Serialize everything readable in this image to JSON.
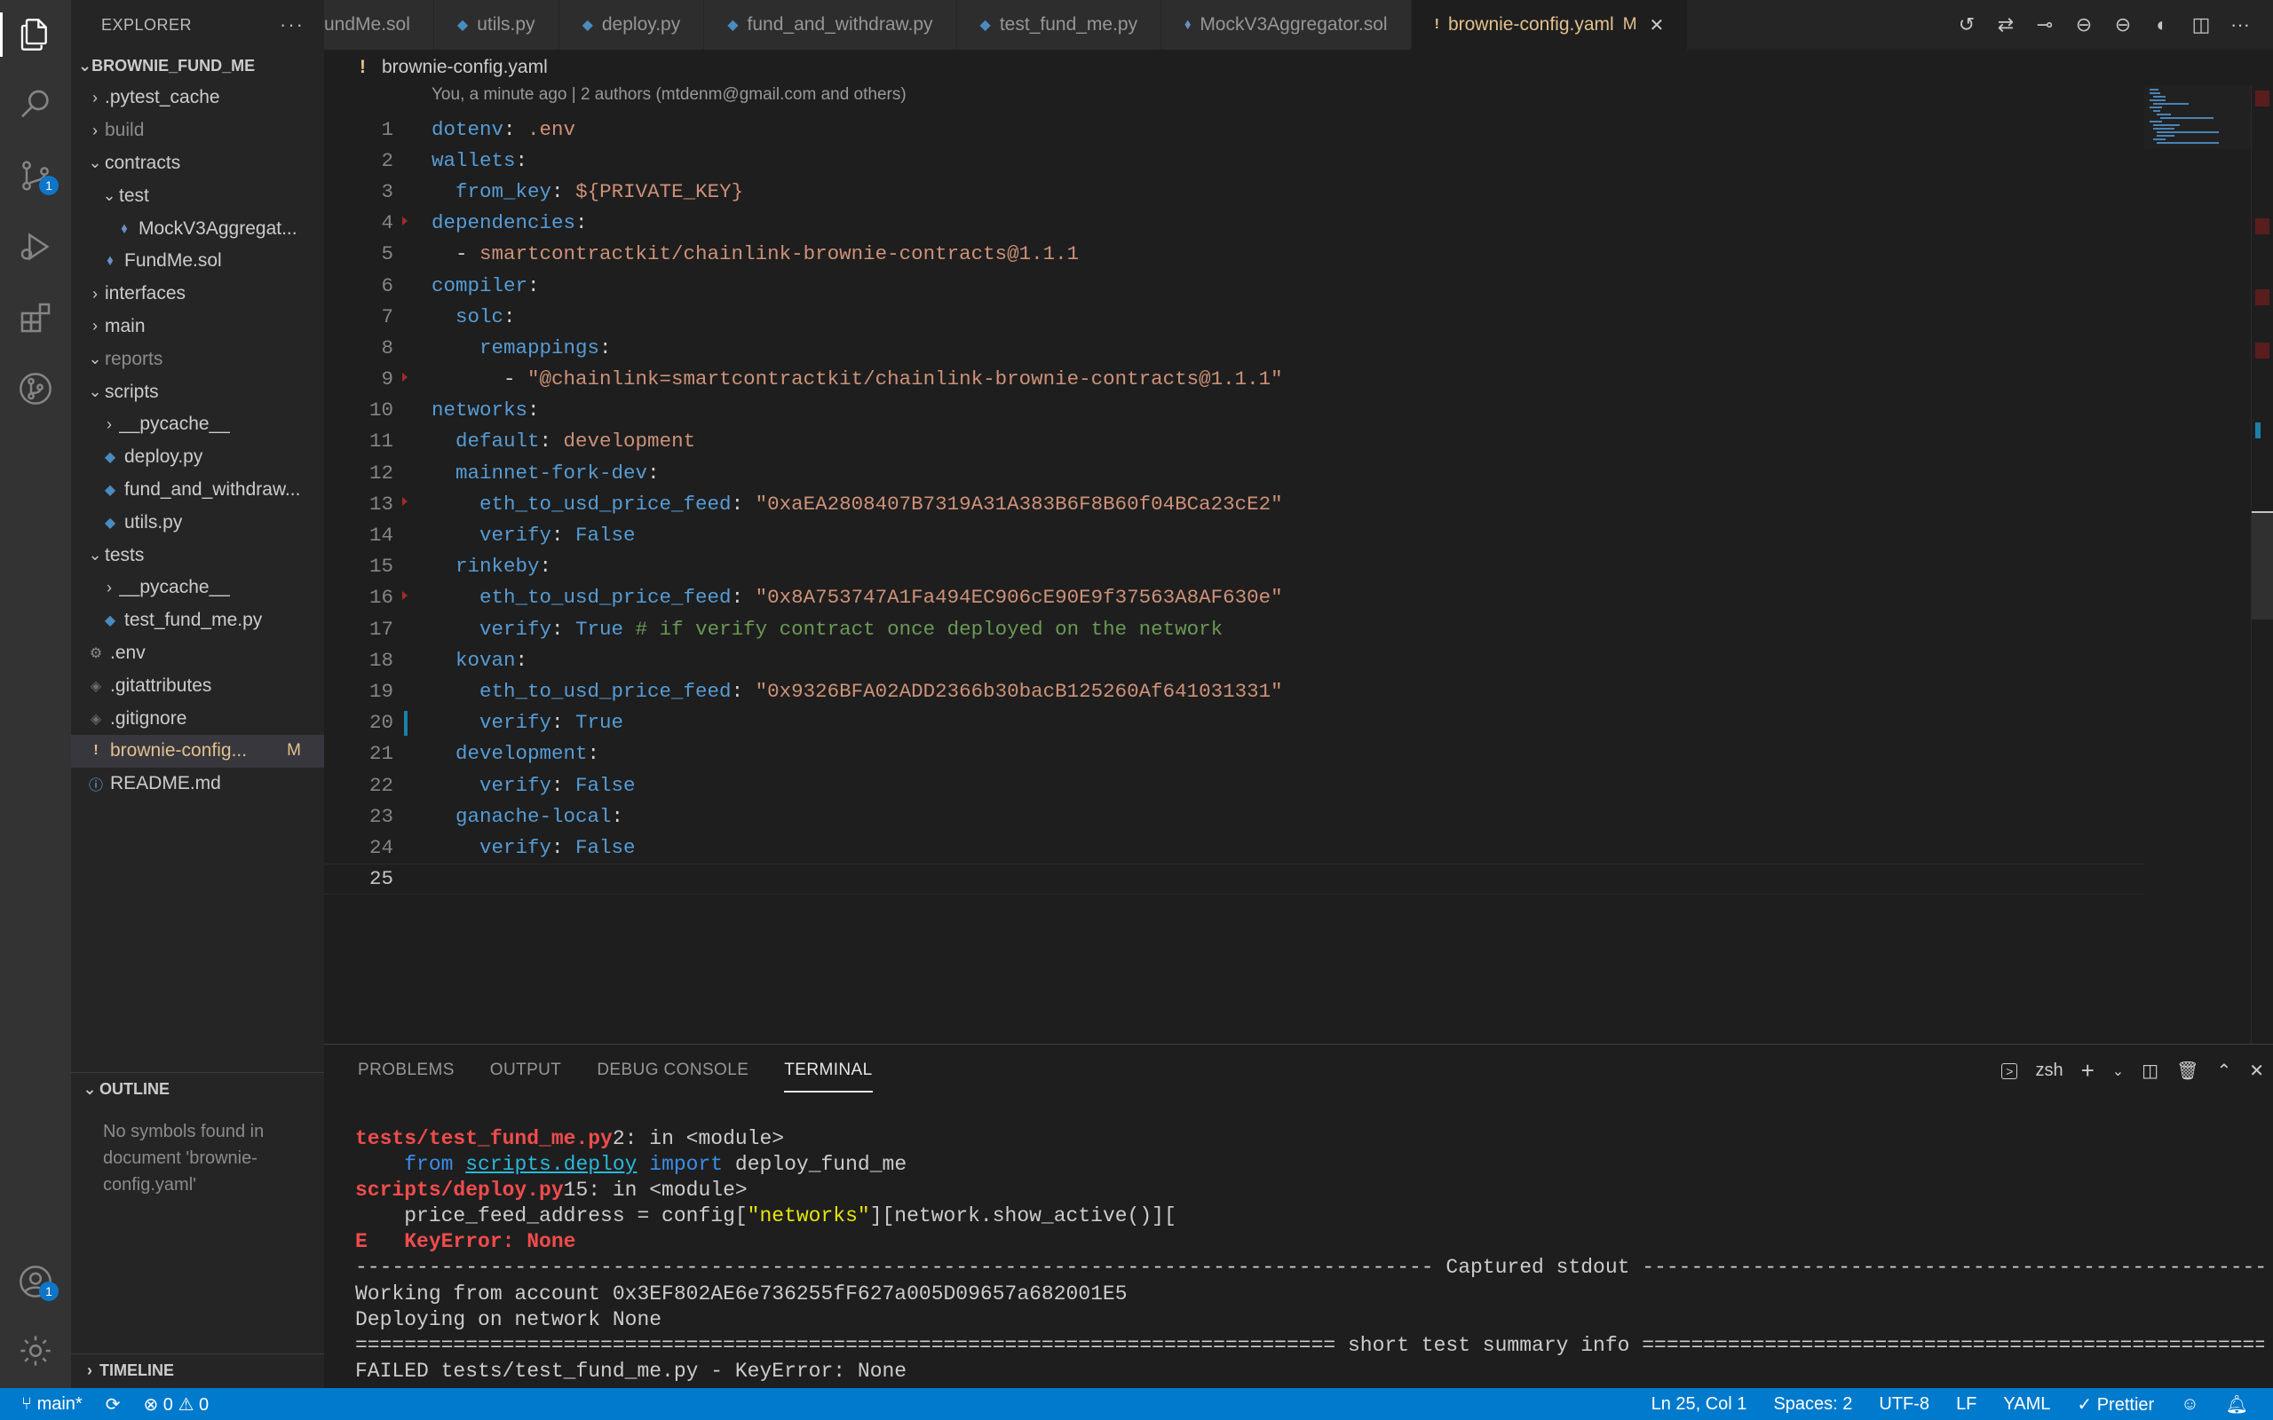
{
  "explorer": {
    "title": "EXPLORER",
    "project": "BROWNIE_FUND_ME",
    "items": [
      {
        "label": ".pytest_cache",
        "kind": "folder",
        "state": "collapsed",
        "depth": 0
      },
      {
        "label": "build",
        "kind": "folder",
        "state": "collapsed",
        "depth": 0,
        "muted": true
      },
      {
        "label": "contracts",
        "kind": "folder",
        "state": "expanded",
        "depth": 0
      },
      {
        "label": "test",
        "kind": "folder",
        "state": "expanded",
        "depth": 1
      },
      {
        "label": "MockV3Aggregat...",
        "kind": "sol",
        "depth": 2
      },
      {
        "label": "FundMe.sol",
        "kind": "sol",
        "depth": 1
      },
      {
        "label": "interfaces",
        "kind": "folder",
        "state": "collapsed",
        "depth": 0
      },
      {
        "label": "main",
        "kind": "folder",
        "state": "collapsed",
        "depth": 0
      },
      {
        "label": "reports",
        "kind": "folder",
        "state": "expanded",
        "depth": 0,
        "muted": true
      },
      {
        "label": "scripts",
        "kind": "folder",
        "state": "expanded",
        "depth": 0
      },
      {
        "label": "__pycache__",
        "kind": "folder",
        "state": "collapsed",
        "depth": 1
      },
      {
        "label": "deploy.py",
        "kind": "py",
        "depth": 1
      },
      {
        "label": "fund_and_withdraw...",
        "kind": "py",
        "depth": 1
      },
      {
        "label": "utils.py",
        "kind": "py",
        "depth": 1
      },
      {
        "label": "tests",
        "kind": "folder",
        "state": "expanded",
        "depth": 0
      },
      {
        "label": "__pycache__",
        "kind": "folder",
        "state": "collapsed",
        "depth": 1
      },
      {
        "label": "test_fund_me.py",
        "kind": "py",
        "depth": 1
      },
      {
        "label": ".env",
        "kind": "env",
        "depth": 0
      },
      {
        "label": ".gitattributes",
        "kind": "git",
        "depth": 0
      },
      {
        "label": ".gitignore",
        "kind": "git",
        "depth": 0
      },
      {
        "label": "brownie-config...",
        "kind": "yaml",
        "depth": 0,
        "selected": true,
        "modified": "M"
      },
      {
        "label": "README.md",
        "kind": "info",
        "depth": 0
      }
    ],
    "outline_title": "OUTLINE",
    "outline_message": "No symbols found in document 'brownie-config.yaml'",
    "timeline_title": "TIMELINE"
  },
  "activity": {
    "scm_badge": "1",
    "accounts_badge": "1"
  },
  "tabs": [
    {
      "label": "undMe.sol",
      "kind": "sol"
    },
    {
      "label": "utils.py",
      "kind": "py"
    },
    {
      "label": "deploy.py",
      "kind": "py"
    },
    {
      "label": "fund_and_withdraw.py",
      "kind": "py"
    },
    {
      "label": "test_fund_me.py",
      "kind": "py"
    },
    {
      "label": "MockV3Aggregator.sol",
      "kind": "sol"
    },
    {
      "label": "brownie-config.yaml",
      "kind": "yaml",
      "active": true,
      "modified": "M"
    }
  ],
  "editor": {
    "breadcrumb": "brownie-config.yaml",
    "blame": "You, a minute ago | 2 authors (mtdenm@gmail.com and others)",
    "current_line": 25,
    "lines": [
      [
        [
          "k",
          "dotenv"
        ],
        [
          "p",
          ": "
        ],
        [
          "s",
          ".env"
        ]
      ],
      [
        [
          "k",
          "wallets"
        ],
        [
          "p",
          ":"
        ]
      ],
      [
        [
          "p",
          "  "
        ],
        [
          "k",
          "from_key"
        ],
        [
          "p",
          ": "
        ],
        [
          "s",
          "${PRIVATE_KEY}"
        ]
      ],
      [
        [
          "k",
          "dependencies"
        ],
        [
          "p",
          ":"
        ]
      ],
      [
        [
          "p",
          "  - "
        ],
        [
          "s",
          "smartcontractkit/chainlink-brownie-contracts@1.1.1"
        ]
      ],
      [
        [
          "k",
          "compiler"
        ],
        [
          "p",
          ":"
        ]
      ],
      [
        [
          "p",
          "  "
        ],
        [
          "k",
          "solc"
        ],
        [
          "p",
          ":"
        ]
      ],
      [
        [
          "p",
          "    "
        ],
        [
          "k",
          "remappings"
        ],
        [
          "p",
          ":"
        ]
      ],
      [
        [
          "p",
          "      - "
        ],
        [
          "s",
          "\"@chainlink=smartcontractkit/chainlink-brownie-contracts@1.1.1\""
        ]
      ],
      [
        [
          "k",
          "networks"
        ],
        [
          "p",
          ":"
        ]
      ],
      [
        [
          "p",
          "  "
        ],
        [
          "k",
          "default"
        ],
        [
          "p",
          ": "
        ],
        [
          "s",
          "development"
        ]
      ],
      [
        [
          "p",
          "  "
        ],
        [
          "k",
          "mainnet-fork-dev"
        ],
        [
          "p",
          ":"
        ]
      ],
      [
        [
          "p",
          "    "
        ],
        [
          "k",
          "eth_to_usd_price_feed"
        ],
        [
          "p",
          ": "
        ],
        [
          "s",
          "\"0xaEA2808407B7319A31A383B6F8B60f04BCa23cE2\""
        ]
      ],
      [
        [
          "p",
          "    "
        ],
        [
          "k",
          "verify"
        ],
        [
          "p",
          ": "
        ],
        [
          "b",
          "False"
        ]
      ],
      [
        [
          "p",
          "  "
        ],
        [
          "k",
          "rinkeby"
        ],
        [
          "p",
          ":"
        ]
      ],
      [
        [
          "p",
          "    "
        ],
        [
          "k",
          "eth_to_usd_price_feed"
        ],
        [
          "p",
          ": "
        ],
        [
          "s",
          "\"0x8A753747A1Fa494EC906cE90E9f37563A8AF630e\""
        ]
      ],
      [
        [
          "p",
          "    "
        ],
        [
          "k",
          "verify"
        ],
        [
          "p",
          ": "
        ],
        [
          "b",
          "True"
        ],
        [
          "c",
          " # if verify contract once deployed on the network"
        ]
      ],
      [
        [
          "p",
          "  "
        ],
        [
          "k",
          "kovan"
        ],
        [
          "p",
          ":"
        ]
      ],
      [
        [
          "p",
          "    "
        ],
        [
          "k",
          "eth_to_usd_price_feed"
        ],
        [
          "p",
          ": "
        ],
        [
          "s",
          "\"0x9326BFA02ADD2366b30bacB125260Af641031331\""
        ]
      ],
      [
        [
          "p",
          "    "
        ],
        [
          "k",
          "verify"
        ],
        [
          "p",
          ": "
        ],
        [
          "b",
          "True"
        ]
      ],
      [
        [
          "p",
          "  "
        ],
        [
          "k",
          "development"
        ],
        [
          "p",
          ":"
        ]
      ],
      [
        [
          "p",
          "    "
        ],
        [
          "k",
          "verify"
        ],
        [
          "p",
          ": "
        ],
        [
          "b",
          "False"
        ]
      ],
      [
        [
          "p",
          "  "
        ],
        [
          "k",
          "ganache-local"
        ],
        [
          "p",
          ":"
        ]
      ],
      [
        [
          "p",
          "    "
        ],
        [
          "k",
          "verify"
        ],
        [
          "p",
          ": "
        ],
        [
          "b",
          "False"
        ]
      ],
      []
    ]
  },
  "panel": {
    "tabs": [
      "PROBLEMS",
      "OUTPUT",
      "DEBUG CONSOLE",
      "TERMINAL"
    ],
    "active_tab": "TERMINAL",
    "shell": "zsh",
    "terminal": [
      [
        [
          "t-red",
          "tests/test_fund_me.py"
        ],
        [
          "",
          "2: in <module>"
        ]
      ],
      [
        [
          "",
          "    "
        ],
        [
          "t-blue",
          "from "
        ],
        [
          "t-cyan",
          "scripts.deploy"
        ],
        [
          "t-blue",
          " import "
        ],
        [
          "",
          "deploy_fund_me"
        ]
      ],
      [
        [
          "t-red",
          "scripts/deploy.py"
        ],
        [
          "",
          "15: in <module>"
        ]
      ],
      [
        [
          "",
          "    price_feed_address = config["
        ],
        [
          "t-yellow",
          "\"networks\""
        ],
        [
          "",
          "][network.show_active()]["
        ]
      ],
      [
        [
          "t-red",
          "E   KeyError: None"
        ]
      ],
      [
        [
          "",
          "---------------------------------------------------------------------------------------- Captured stdout -----------------------------------------------------------------------------------------"
        ]
      ],
      [
        [
          "",
          "Working from account 0x3EF802AE6e736255fF627a005D09657a682001E5"
        ]
      ],
      [
        [
          "",
          "Deploying on network None"
        ]
      ],
      [
        [
          "",
          "================================================================================ short test summary info ================================================================================"
        ]
      ],
      [
        [
          "",
          "FAILED tests/test_fund_me.py - KeyError: None"
        ]
      ]
    ]
  },
  "statusbar": {
    "branch": "main*",
    "errors": "0",
    "warnings": "0",
    "position": "Ln 25, Col 1",
    "spaces": "Spaces: 2",
    "encoding": "UTF-8",
    "eol": "LF",
    "language": "YAML",
    "formatter": "Prettier"
  }
}
